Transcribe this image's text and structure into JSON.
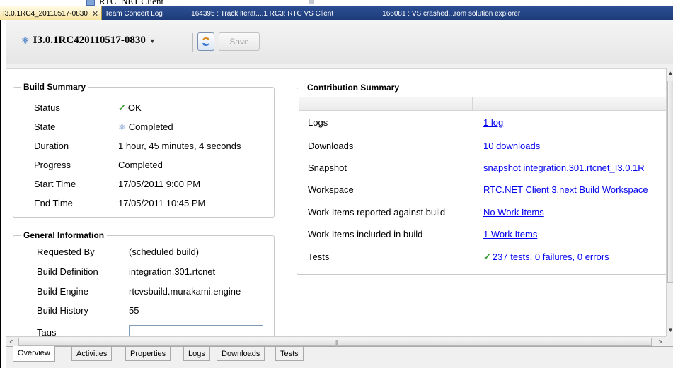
{
  "background_window": {
    "fragment_label": "RTC .NET Client"
  },
  "editor_tabs": [
    {
      "label": "I3.0.1RC4_20110517-0830",
      "active": true,
      "close_icon": "close-icon"
    },
    {
      "label": "Team Concert Log",
      "active": false
    },
    {
      "label": "164395 : Track iterat....1 RC3: RTC VS Client",
      "active": false
    },
    {
      "label": "166081 : VS crashed...rom solution explorer",
      "active": false
    }
  ],
  "toolbar": {
    "build_title": "I3.0.1RC420110517-0830",
    "build_title_icon": "build-result-icon",
    "refresh_icon": "refresh-icon",
    "save_label": "Save"
  },
  "build_summary": {
    "title": "Build Summary",
    "rows": [
      {
        "label": "Status",
        "value": "OK",
        "icon": "check-icon"
      },
      {
        "label": "State",
        "value": "Completed",
        "icon": "build-state-icon"
      },
      {
        "label": "Duration",
        "value": "1 hour, 45 minutes, 4 seconds"
      },
      {
        "label": "Progress",
        "value": "Completed"
      },
      {
        "label": "Start Time",
        "value": "17/05/2011 9:00 PM"
      },
      {
        "label": "End Time",
        "value": "17/05/2011 10:45 PM"
      }
    ]
  },
  "general_information": {
    "title": "General Information",
    "rows": [
      {
        "label": "Requested By",
        "value": "(scheduled build)"
      },
      {
        "label": "Build Definition",
        "value": "integration.301.rtcnet"
      },
      {
        "label": "Build Engine",
        "value": "rtcvsbuild.murakami.engine"
      },
      {
        "label": "Build History",
        "value": "55"
      },
      {
        "label": "Tags",
        "value": ""
      }
    ]
  },
  "contribution_summary": {
    "title": "Contribution Summary",
    "rows": [
      {
        "label": "Logs",
        "link": "1 log"
      },
      {
        "label": "Downloads",
        "link": "10 downloads"
      },
      {
        "label": "Snapshot",
        "link": "snapshot integration.301.rtcnet_I3.0.1R"
      },
      {
        "label": "Workspace",
        "link": "RTC.NET Client 3.next Build Workspace"
      },
      {
        "label": "Work Items reported against build",
        "link": "No Work Items"
      },
      {
        "label": "Work Items included in build",
        "link": "1 Work Items"
      },
      {
        "label": "Tests",
        "link": "237 tests, 0 failures, 0 errors",
        "icon": "check-icon"
      }
    ]
  },
  "scrollbars": {
    "vertical_up": "▲",
    "vertical_down": "▼",
    "horizontal_left": "<",
    "horizontal_right": ">",
    "grip": "|||"
  },
  "bottom_tabs": [
    {
      "label": "Overview",
      "active": true
    },
    {
      "label": "Activities",
      "active": false
    },
    {
      "label": "Properties",
      "active": false
    },
    {
      "label": "Logs",
      "active": false
    },
    {
      "label": "Downloads",
      "active": false
    },
    {
      "label": "Tests",
      "active": false
    }
  ]
}
